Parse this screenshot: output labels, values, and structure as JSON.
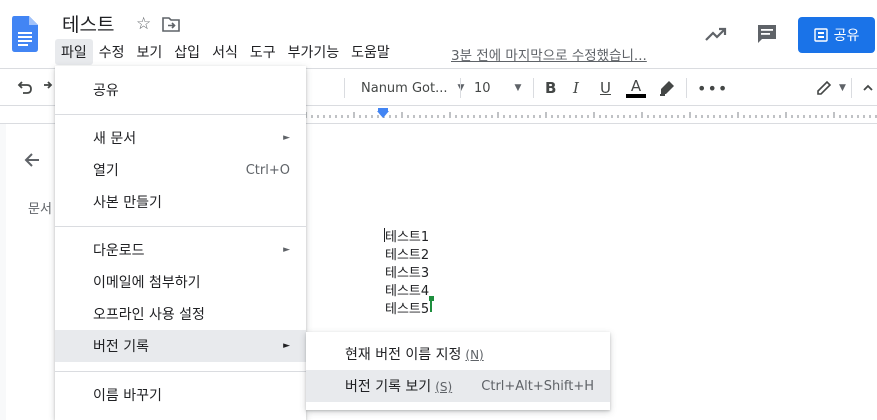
{
  "document": {
    "title": "테스트",
    "last_edit": "3분 전에 마지막으로 수정했습니..."
  },
  "menubar": {
    "items": [
      "파일",
      "수정",
      "보기",
      "삽입",
      "서식",
      "도구",
      "부가기능",
      "도움말"
    ],
    "active_index": 0
  },
  "header": {
    "share_label": "공유",
    "icons": [
      "docs-logo-icon",
      "star-icon",
      "move-to-folder-icon",
      "activity-trend-icon",
      "comment-icon",
      "lock-icon"
    ]
  },
  "toolbar": {
    "font_family": "Nanum Got...",
    "font_size": "10",
    "bold": "B",
    "italic": "I",
    "underline": "U",
    "text_color": "A",
    "icons": [
      "undo-icon",
      "redo-icon",
      "highlight-icon",
      "more-icon",
      "edit-mode-icon",
      "collapse-icon"
    ]
  },
  "outline": {
    "label": "문서"
  },
  "body_lines": [
    "테스트1",
    "테스트2",
    "테스트3",
    "테스트4",
    "테스트5"
  ],
  "file_menu": {
    "items": [
      {
        "label": "공유",
        "shortcut": "",
        "submenu": false
      },
      {
        "label": "새 문서",
        "shortcut": "",
        "submenu": true
      },
      {
        "label": "열기",
        "shortcut": "Ctrl+O",
        "submenu": false
      },
      {
        "label": "사본 만들기",
        "shortcut": "",
        "submenu": false
      },
      {
        "label": "다운로드",
        "shortcut": "",
        "submenu": true
      },
      {
        "label": "이메일에 첨부하기",
        "shortcut": "",
        "submenu": false
      },
      {
        "label": "오프라인 사용 설정",
        "shortcut": "",
        "submenu": false
      },
      {
        "label": "버전 기록",
        "shortcut": "",
        "submenu": true,
        "highlighted": true
      },
      {
        "label": "이름 바꾸기",
        "shortcut": "",
        "submenu": false
      }
    ],
    "submenu_arrow": "►"
  },
  "version_history_menu": {
    "items": [
      {
        "label": "현재 버전 이름 지정",
        "accelerator": "(N)",
        "shortcut": ""
      },
      {
        "label": "버전 기록 보기",
        "accelerator": "(S)",
        "shortcut": "Ctrl+Alt+Shift+H",
        "highlighted": true
      }
    ]
  },
  "colors": {
    "accent": "#1a73e8",
    "docs_blue": "#4285f4",
    "menu_highlight": "#e8eaed",
    "text_color_bar": "#000000",
    "collab_cursor": "#1e8e3e"
  }
}
